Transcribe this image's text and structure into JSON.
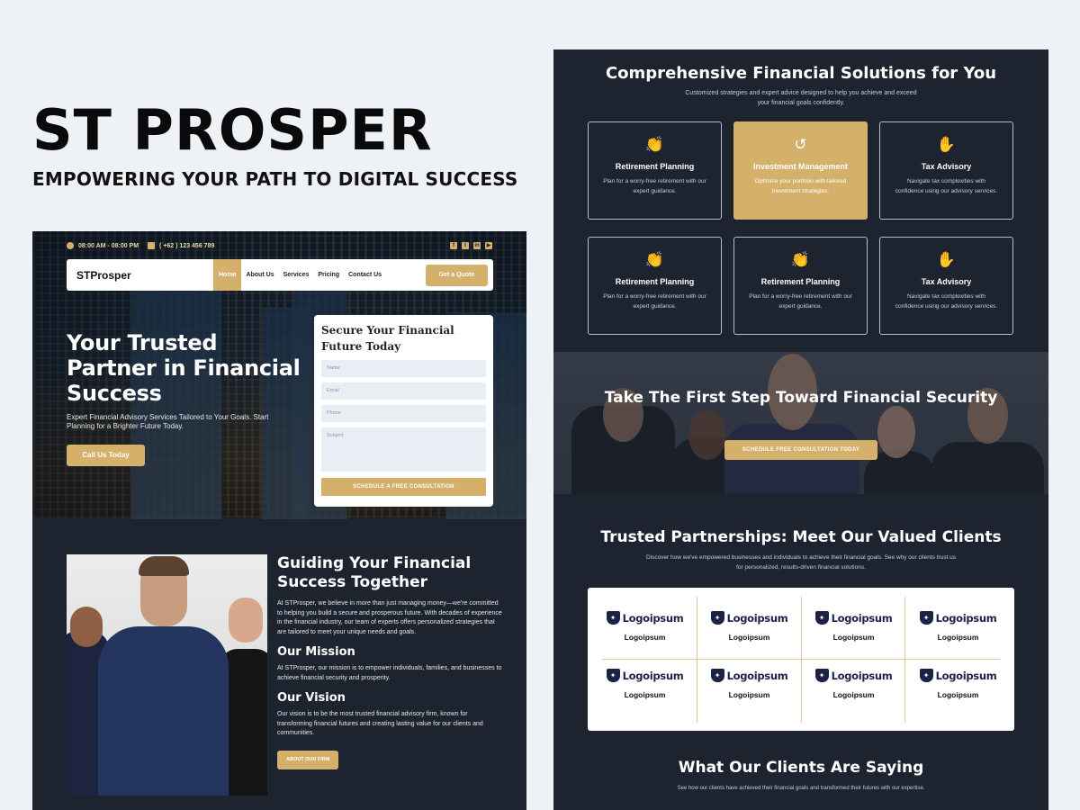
{
  "brand": {
    "title": "ST PROSPER",
    "tagline": "EMPOWERING YOUR PATH TO DIGITAL SUCCESS"
  },
  "colors": {
    "accent": "#d4b06a",
    "dark_bg": "#1d2430",
    "page_bg": "#eef1f5"
  },
  "left_page": {
    "topbar": {
      "hours": "08:00 AM - 08:00 PM",
      "phone": "( +62 ) 123 456 789",
      "social_icons": [
        "facebook-icon",
        "twitter-icon",
        "linkedin-icon",
        "youtube-icon"
      ]
    },
    "navbar": {
      "logo": "STProsper",
      "items": [
        {
          "label": "Home",
          "active": true
        },
        {
          "label": "About Us",
          "active": false
        },
        {
          "label": "Services",
          "active": false
        },
        {
          "label": "Pricing",
          "active": false
        },
        {
          "label": "Contact Us",
          "active": false
        }
      ],
      "cta": "Get a Quote"
    },
    "hero": {
      "title": "Your Trusted Partner in Financial Success",
      "subtitle": "Expert Financial Advisory Services Tailored to Your Goals. Start Planning for a Brighter Future Today.",
      "button": "Call Us Today"
    },
    "form": {
      "title": "Secure Your Financial Future Today",
      "fields": {
        "name_placeholder": "Name",
        "email_placeholder": "Email",
        "phone_placeholder": "Phone",
        "subject_placeholder": "Subject"
      },
      "submit": "SCHEDULE A FREE CONSULTATION"
    },
    "about": {
      "title": "Guiding Your Financial Success Together",
      "intro": "At STProsper, we believe in more than just managing money—we're committed to helping you build a secure and prosperous future. With decades of experience in the financial industry, our team of experts offers personalized strategies that are tailored to meet your unique needs and goals.",
      "mission_title": "Our Mission",
      "mission_text": "At STProsper, our mission is to empower individuals, families, and businesses to achieve financial security and prosperity.",
      "vision_title": "Our Vision",
      "vision_text": "Our vision is to be the most trusted financial advisory firm, known for transforming financial futures and creating lasting value for our clients and communities.",
      "button": "ABOUT OUR FIRM"
    }
  },
  "right_page": {
    "services": {
      "title": "Comprehensive Financial Solutions for You",
      "subtitle": "Customized strategies and expert advice designed to help you achieve and exceed your financial goals confidently.",
      "cards": [
        {
          "icon": "clapping-hands-icon",
          "title": "Retirement Planning",
          "desc": "Plan for a worry-free retirement with our expert guidance.",
          "active": false
        },
        {
          "icon": "history-icon",
          "title": "Investment Management",
          "desc": "Optimize your portfolio with tailored investment strategies.",
          "active": true
        },
        {
          "icon": "hand-sparkle-icon",
          "title": "Tax Advisory",
          "desc": "Navigate tax complexities with confidence using our advisory services.",
          "active": false
        },
        {
          "icon": "clapping-hands-icon",
          "title": "Retirement Planning",
          "desc": "Plan for a worry-free retirement with our expert guidance.",
          "active": false
        },
        {
          "icon": "clapping-hands-icon",
          "title": "Retirement Planning",
          "desc": "Plan for a worry-free retirement with our expert guidance.",
          "active": false
        },
        {
          "icon": "hand-sparkle-icon",
          "title": "Tax Advisory",
          "desc": "Navigate tax complexities with confidence using our advisory services.",
          "active": false
        }
      ]
    },
    "cta": {
      "title": "Take The First Step Toward Financial Security",
      "button": "SCHEDULE FREE CONSULTATION TODAY"
    },
    "clients": {
      "title": "Trusted Partnerships: Meet Our Valued Clients",
      "subtitle": "Discover how we've empowered businesses and individuals to achieve their financial goals. See why our clients trust us for personalized, results-driven financial solutions.",
      "logos": [
        {
          "logo_text": "Logoipsum",
          "name": "Logoipsum"
        },
        {
          "logo_text": "Logoipsum",
          "name": "Logoipsum"
        },
        {
          "logo_text": "Logoipsum",
          "name": "Logoipsum"
        },
        {
          "logo_text": "Logoipsum",
          "name": "Logoipsum"
        },
        {
          "logo_text": "Logoipsum",
          "name": "Logoipsum"
        },
        {
          "logo_text": "Logoipsum",
          "name": "Logoipsum"
        },
        {
          "logo_text": "Logoipsum",
          "name": "Logoipsum"
        },
        {
          "logo_text": "Logoipsum",
          "name": "Logoipsum"
        }
      ]
    },
    "testimonials": {
      "title": "What Our Clients Are Saying",
      "subtitle": "See how our clients have achieved their financial goals and transformed their futures with our expertise."
    }
  }
}
